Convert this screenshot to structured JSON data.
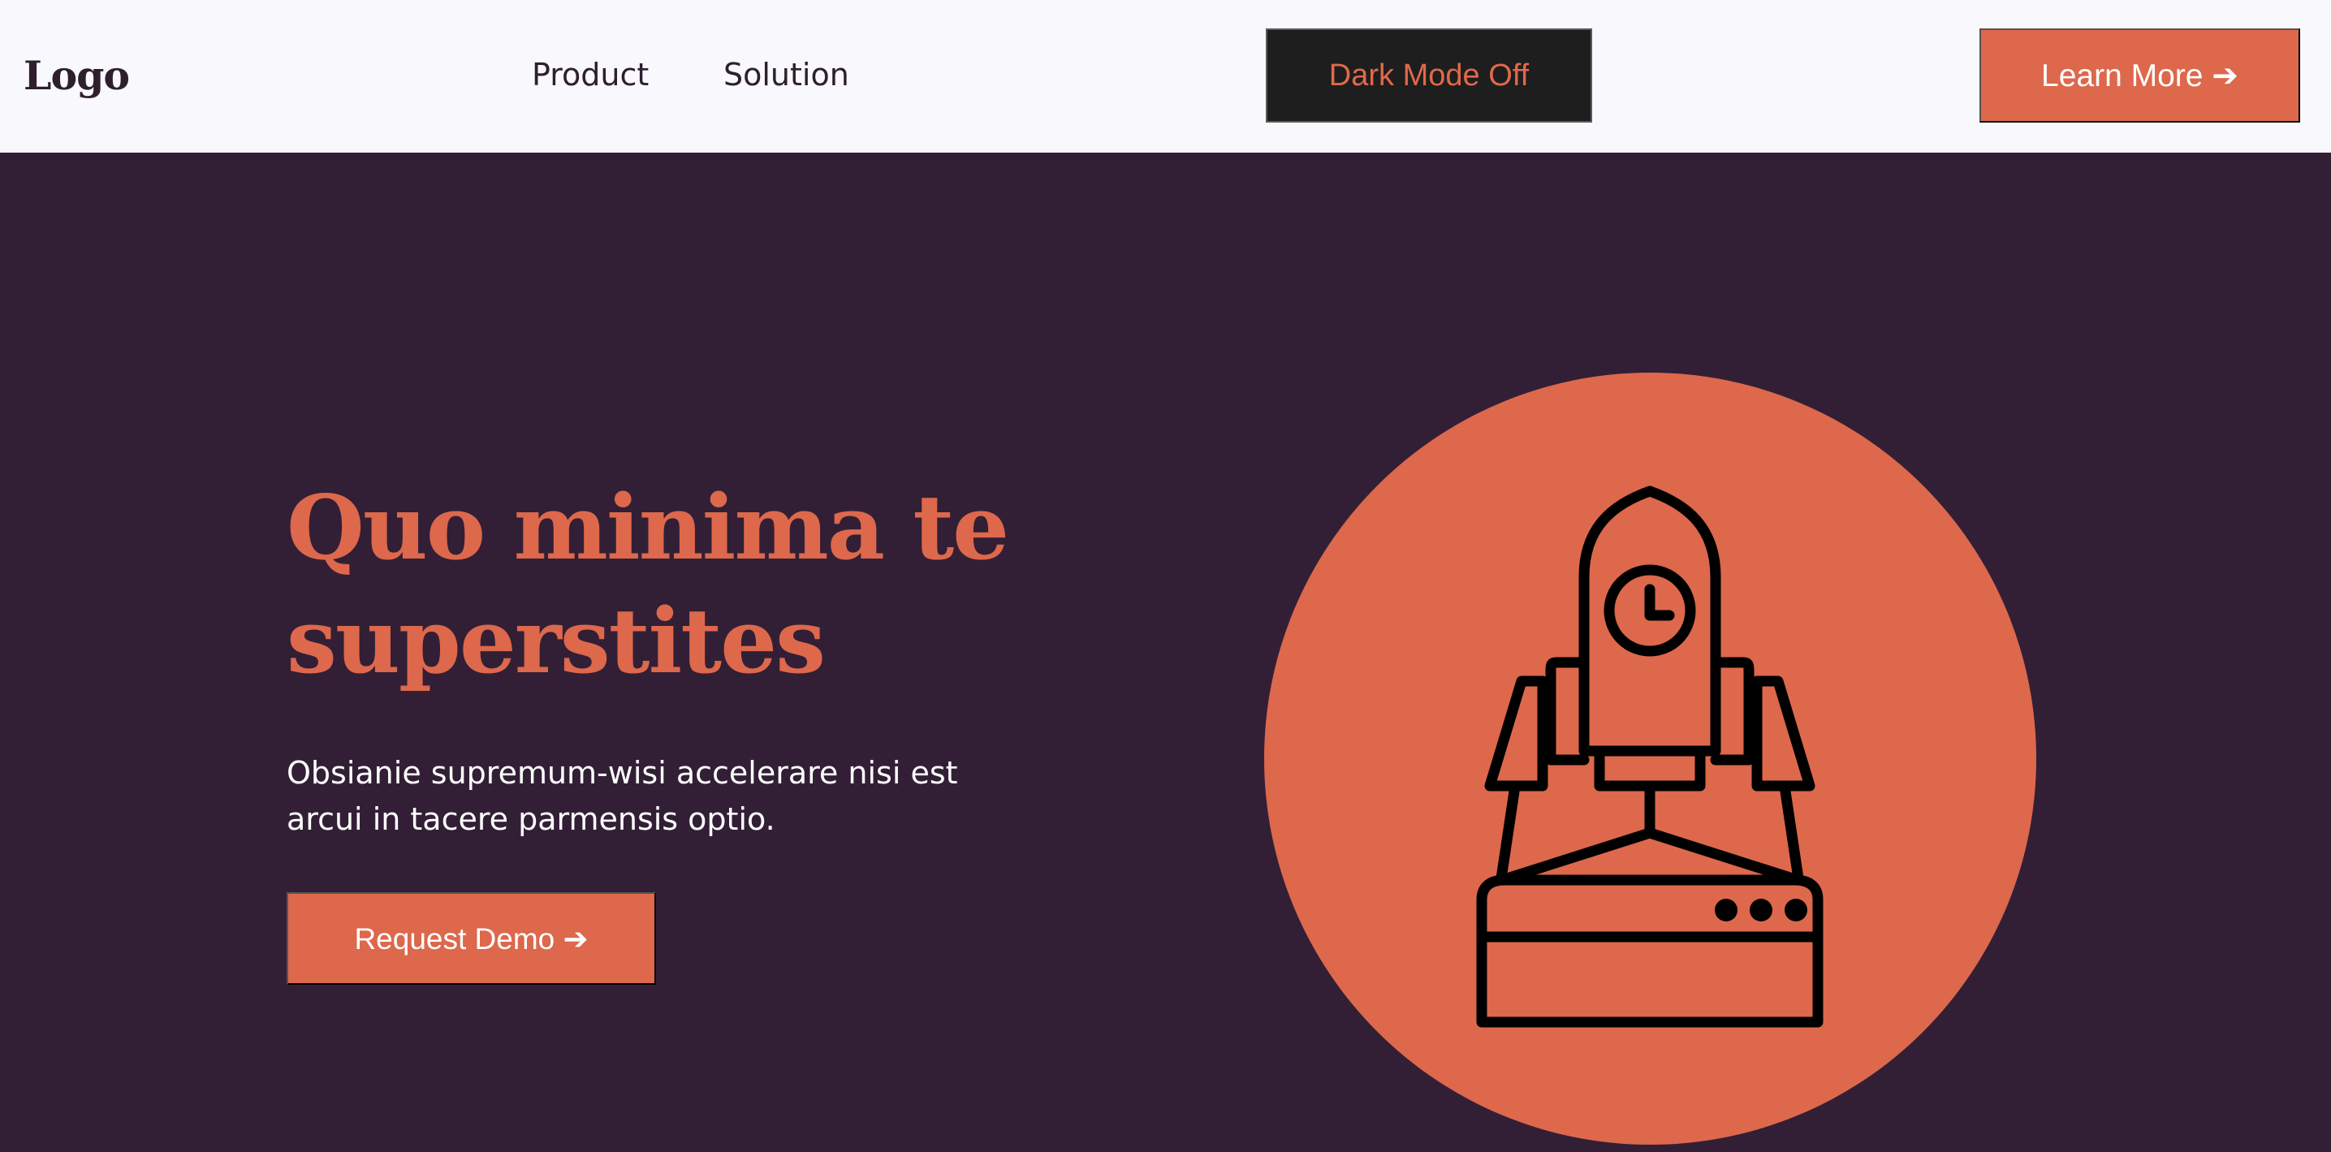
{
  "header": {
    "logo": "Logo",
    "nav": [
      {
        "label": "Product"
      },
      {
        "label": "Solution"
      }
    ],
    "dark_mode_button": "Dark Mode Off",
    "learn_more_button": "Learn More ➔"
  },
  "hero": {
    "title_line1": "Quo minima te",
    "title_line2": "superstites",
    "description_line1": "Obsianie supremum-wisi accelerare nisi est",
    "description_line2": "arcui in tacere parmensis optio.",
    "cta_button": "Request Demo ➔",
    "illustration_icon": "rocket-launch-icon"
  },
  "colors": {
    "accent": "#dd684c",
    "background": "#321f35",
    "header_background": "#f9f8fc",
    "dark_button": "#1e1e1e",
    "icon_stroke": "#000000"
  }
}
